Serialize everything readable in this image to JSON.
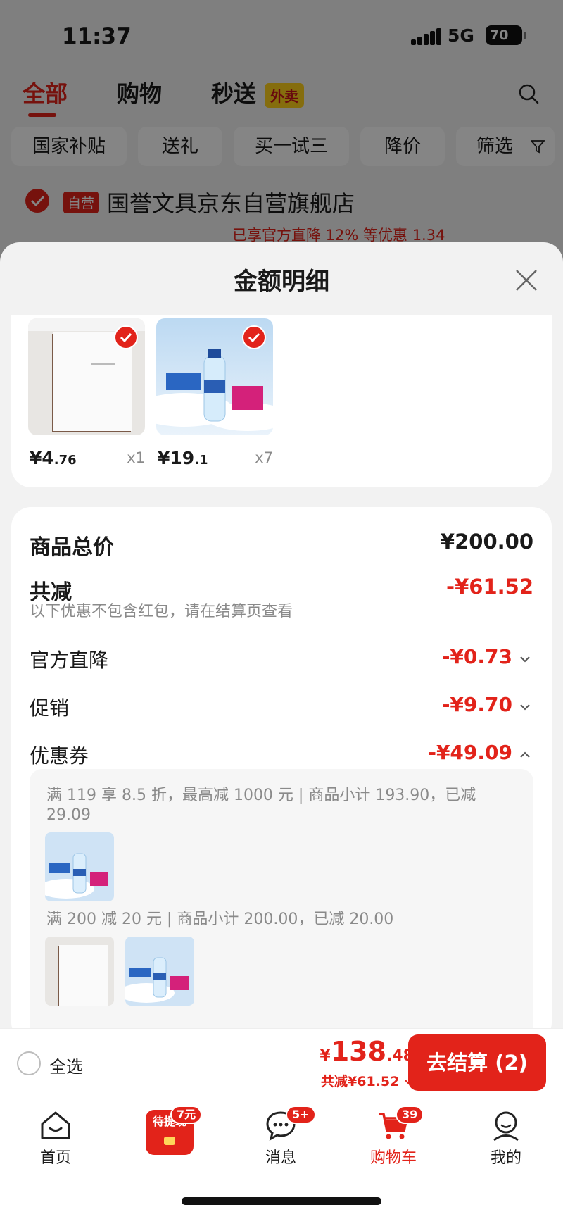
{
  "status": {
    "time": "11:37",
    "network": "5G",
    "battery": "70"
  },
  "top_tabs": [
    {
      "label": "全部",
      "active": true
    },
    {
      "label": "购物",
      "active": false
    },
    {
      "label": "秒送",
      "active": false
    }
  ],
  "waimai_tag": "外卖",
  "filter_chips": [
    "国家补贴",
    "送礼",
    "买一试三",
    "降价",
    "筛选"
  ],
  "store": {
    "self_tag": "自营",
    "name": "国誉文具京东自营旗舰店",
    "promo": "已享官方直降 12% 等优惠 1.34"
  },
  "sheet": {
    "title": "金额明细",
    "products": [
      {
        "price_int": "¥4",
        "price_dec": ".76",
        "qty": "x1",
        "image": "notebook"
      },
      {
        "price_int": "¥19",
        "price_dec": ".1",
        "qty": "x7",
        "image": "water"
      }
    ],
    "total_label": "商品总价",
    "total_value": "¥200.00",
    "discount_label": "共减",
    "discount_value": "-¥61.52",
    "note": "以下优惠不包含红包，请在结算页查看",
    "lines": [
      {
        "label": "官方直降",
        "value": "-¥0.73",
        "chevron": "down"
      },
      {
        "label": "促销",
        "value": "-¥9.70",
        "chevron": "down"
      },
      {
        "label": "优惠券",
        "value": "-¥49.09",
        "chevron": "up"
      }
    ],
    "coupons": [
      {
        "text_line1": "满 119 享 8.5 折，最高减 1000 元 | 商品小计 193.90，已减",
        "text_line2": "29.09",
        "products": [
          "water"
        ]
      },
      {
        "text_line1": "满 200 减 20 元 | 商品小计 200.00，已减 20.00",
        "products": [
          "notebook",
          "water"
        ]
      }
    ]
  },
  "checkout": {
    "select_all": "全选",
    "total_yen": "¥",
    "total_int": "138",
    "total_dec": ".48",
    "saved": "共减¥61.52",
    "button": "去结算 (2)"
  },
  "tabbar": [
    {
      "label": "首页",
      "icon": "home-icon"
    },
    {
      "label": "",
      "icon": "red-packet-icon",
      "badge": "7元",
      "image_text": "待提现"
    },
    {
      "label": "消息",
      "icon": "message-icon",
      "badge": "5+"
    },
    {
      "label": "购物车",
      "icon": "cart-icon",
      "badge": "39",
      "active": true
    },
    {
      "label": "我的",
      "icon": "profile-icon"
    }
  ],
  "colors": {
    "accent": "#e2231a",
    "yellow_tag": "#ffd21c"
  }
}
